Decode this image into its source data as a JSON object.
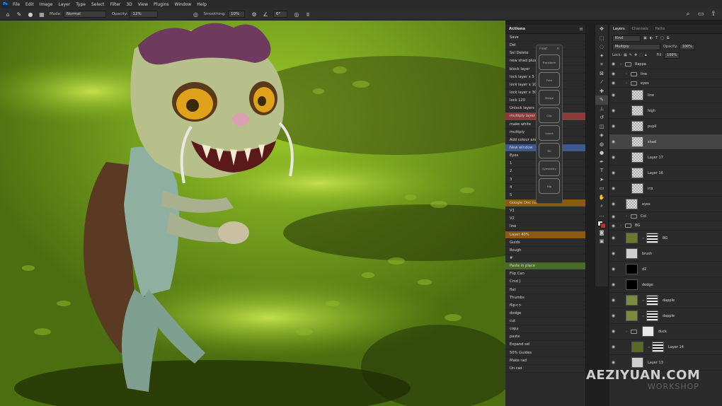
{
  "menu": {
    "logo": "Ps",
    "items": [
      "File",
      "Edit",
      "Image",
      "Layer",
      "Type",
      "Select",
      "Filter",
      "3D",
      "View",
      "Plugins",
      "Window",
      "Help"
    ]
  },
  "options": {
    "mode_label": "Mode:",
    "mode_value": "Normal",
    "opacity_label": "Opacity:",
    "opacity_value": "12%",
    "smoothing_label": "Smoothing:",
    "smoothing_value": "10%",
    "angle_value": "0°"
  },
  "actions": {
    "title": "Actions",
    "items": [
      {
        "label": "Save",
        "color": ""
      },
      {
        "label": "Del",
        "color": ""
      },
      {
        "label": "Sel Delete",
        "color": ""
      },
      {
        "label": "new shad plus co",
        "color": ""
      },
      {
        "label": "block layer",
        "color": ""
      },
      {
        "label": "lock layer x 5",
        "color": ""
      },
      {
        "label": "lock layer x 10",
        "color": ""
      },
      {
        "label": "lock layer x 30",
        "color": ""
      },
      {
        "label": "lock 120",
        "color": ""
      },
      {
        "label": "Unlock layers",
        "color": ""
      },
      {
        "label": "multiply layer clip",
        "color": "#8a3a3a"
      },
      {
        "label": "make white",
        "color": ""
      },
      {
        "label": "multiply",
        "color": ""
      },
      {
        "label": "Add colour and p",
        "color": ""
      },
      {
        "label": "New window",
        "color": "#3d5a8a"
      },
      {
        "label": "Eyes",
        "color": ""
      },
      {
        "label": "1",
        "color": ""
      },
      {
        "label": "2",
        "color": ""
      },
      {
        "label": "3",
        "color": ""
      },
      {
        "label": "4",
        "color": ""
      },
      {
        "label": "5",
        "color": ""
      },
      {
        "label": "Google Doc cut",
        "color": "#8a5a12"
      },
      {
        "label": "V1",
        "color": ""
      },
      {
        "label": "V2",
        "color": ""
      },
      {
        "label": "line",
        "color": ""
      },
      {
        "label": "Layer 40%",
        "color": "#8a5a12"
      },
      {
        "label": "Guids",
        "color": ""
      },
      {
        "label": "Rough",
        "color": ""
      },
      {
        "label": "#",
        "color": ""
      },
      {
        "label": "Paste in place",
        "color": "#4a6a2a"
      },
      {
        "label": "Flip Can",
        "color": ""
      },
      {
        "label": "Cmd J",
        "color": ""
      },
      {
        "label": "flat",
        "color": ""
      },
      {
        "label": "Thumbs",
        "color": ""
      },
      {
        "label": "flip<>",
        "color": ""
      },
      {
        "label": "dodge",
        "color": ""
      },
      {
        "label": "cut",
        "color": ""
      },
      {
        "label": "copy",
        "color": ""
      },
      {
        "label": "paste",
        "color": ""
      },
      {
        "label": "Expand sel",
        "color": ""
      },
      {
        "label": "50% Guides",
        "color": ""
      },
      {
        "label": "Make rad",
        "color": ""
      },
      {
        "label": "Un-rad",
        "color": ""
      }
    ]
  },
  "fx_panel": {
    "title": "Float",
    "buttons": [
      "Transform",
      "Free",
      "Merge",
      "Clip",
      "Invert",
      "Fill",
      "Symmetry",
      "Flip"
    ]
  },
  "layers_panel": {
    "tabs": [
      "Layers",
      "Channels",
      "Paths"
    ],
    "kind": "Kind",
    "blend": "Multiply",
    "opacity_label": "Opacity:",
    "opacity": "100%",
    "lock_label": "Lock:",
    "fill_label": "Fill:",
    "fill": "100%",
    "rows": [
      {
        "name": "Rappa",
        "type": "group",
        "indent": 0,
        "h": 14
      },
      {
        "name": "line",
        "type": "group",
        "indent": 1,
        "h": 14
      },
      {
        "name": "eyes",
        "type": "group",
        "indent": 1,
        "h": 12
      },
      {
        "name": "line",
        "type": "layer",
        "indent": 2,
        "h": 22
      },
      {
        "name": "high",
        "type": "layer",
        "indent": 2,
        "h": 22
      },
      {
        "name": "pupil",
        "type": "layer",
        "indent": 2,
        "h": 22
      },
      {
        "name": "shad",
        "type": "layer",
        "indent": 2,
        "h": 22,
        "selected": true
      },
      {
        "name": "Layer 17",
        "type": "layer",
        "indent": 2,
        "h": 22
      },
      {
        "name": "Layer 16",
        "type": "layer",
        "indent": 2,
        "h": 22
      },
      {
        "name": "iris",
        "type": "layer",
        "indent": 2,
        "h": 22
      },
      {
        "name": "eyes",
        "type": "layer",
        "indent": 1,
        "h": 22
      },
      {
        "name": "Col",
        "type": "group",
        "indent": 1,
        "h": 13
      },
      {
        "name": "BG",
        "type": "group",
        "indent": 0,
        "h": 13
      },
      {
        "name": "BG",
        "type": "layer",
        "indent": 1,
        "h": 22,
        "thumb": "#6b7a2a",
        "mask": true
      },
      {
        "name": "brush",
        "type": "layer",
        "indent": 1,
        "h": 22,
        "thumb": "#cfcfcf"
      },
      {
        "name": "d2",
        "type": "layer",
        "indent": 1,
        "h": 22,
        "thumb": "#000000"
      },
      {
        "name": "dodge",
        "type": "layer",
        "indent": 1,
        "h": 22,
        "thumb": "#000000"
      },
      {
        "name": "dapple",
        "type": "layer",
        "indent": 1,
        "h": 22,
        "thumb": "#7c8a3e",
        "mask": true
      },
      {
        "name": "dapple",
        "type": "layer",
        "indent": 1,
        "h": 22,
        "thumb": "#7c8a3e",
        "mask": true
      },
      {
        "name": "duck",
        "type": "group",
        "indent": 1,
        "h": 22,
        "mask": true
      },
      {
        "name": "Layer 14",
        "type": "layer",
        "indent": 2,
        "h": 22,
        "thumb": "#5a6a20",
        "mask": true
      },
      {
        "name": "Layer 13",
        "type": "layer",
        "indent": 2,
        "h": 22,
        "thumb": "#cfcfcf"
      }
    ]
  },
  "watermark": "AEZIYUAN.COM",
  "watermark2": "WORKSHOP"
}
